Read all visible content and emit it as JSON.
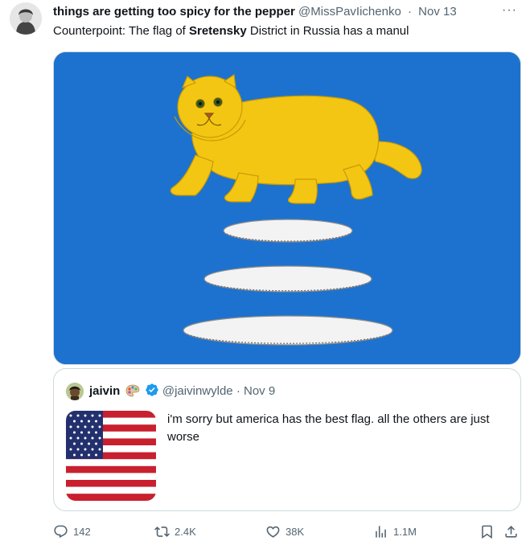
{
  "tweet": {
    "display_name": "things are getting too spicy for the pepper",
    "handle": "@MissPavIichenko",
    "separator": "·",
    "date": "Nov 13",
    "more": "···",
    "text_parts": [
      "Counterpoint: The flag of ",
      "Sretensky",
      " District in Russia has a manul"
    ]
  },
  "quote": {
    "display_name": "jaivin",
    "handle": "@jaivinwylde",
    "separator": "·",
    "date": "Nov 9",
    "text": "i'm sorry but america has the best flag. all the others are just worse"
  },
  "actions": {
    "replies": "142",
    "reposts": "2.4K",
    "likes": "38K",
    "views": "1.1M"
  },
  "icons": {
    "more": "more-icon",
    "verified": "verified-badge-icon",
    "palette": "palette-emoji-icon",
    "reply": "reply-icon",
    "repost": "repost-icon",
    "like": "like-icon",
    "views": "views-icon",
    "bookmark": "bookmark-icon",
    "share": "share-icon"
  },
  "colors": {
    "flag_blue": "#1d72cf",
    "manul_gold": "#f3c614",
    "verified_blue": "#1d9bf0",
    "secondary_text": "#536471"
  }
}
